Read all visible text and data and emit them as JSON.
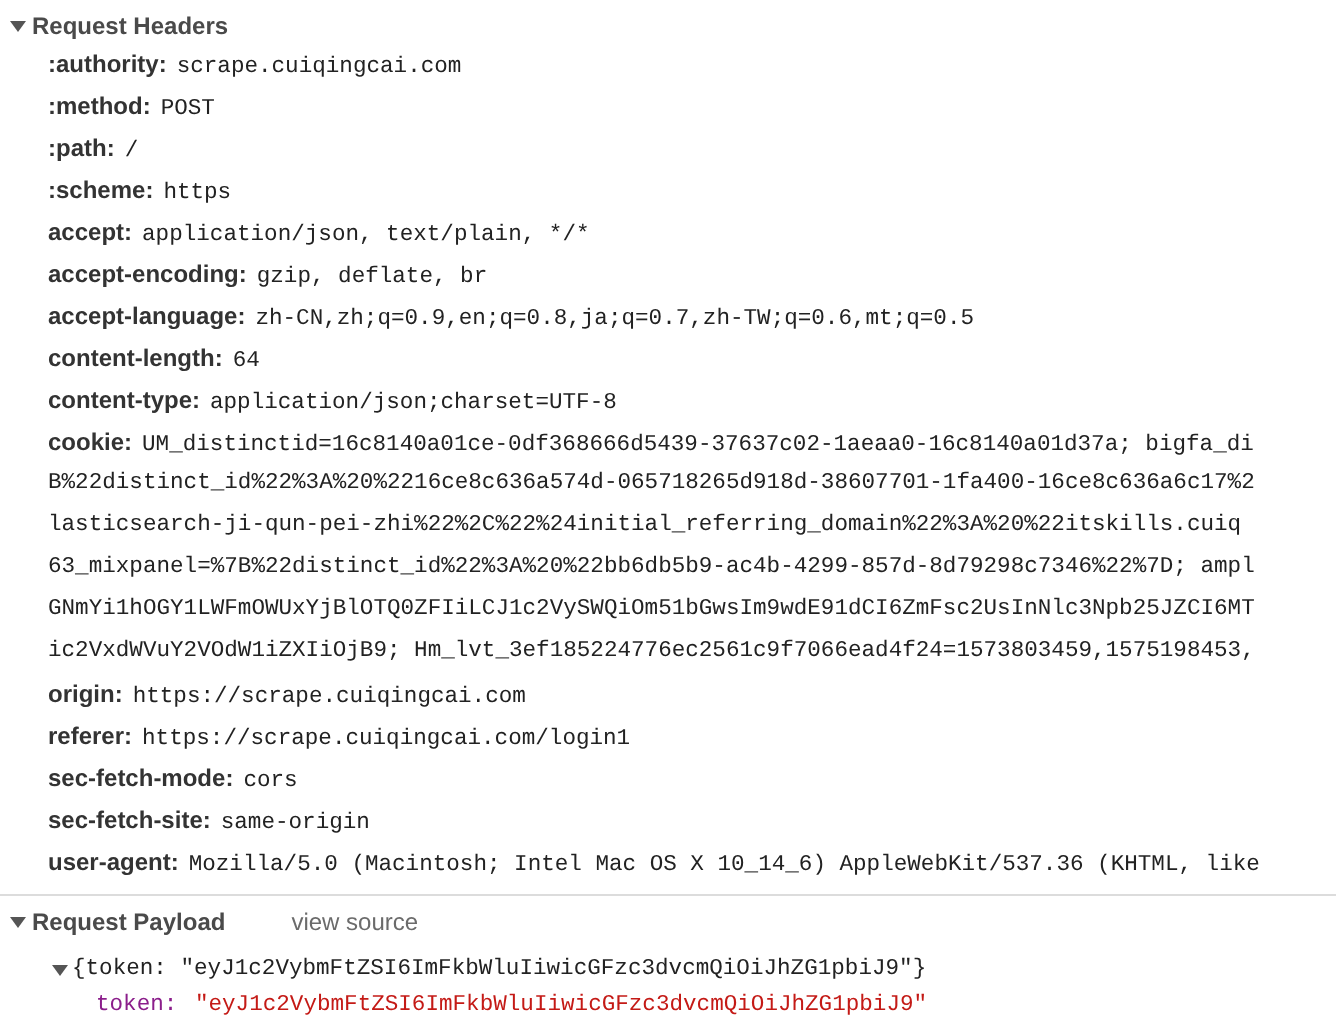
{
  "request_headers": {
    "title": "Request Headers",
    "expanded": true,
    "items": [
      {
        "name": ":authority:",
        "value": "scrape.cuiqingcai.com"
      },
      {
        "name": ":method:",
        "value": "POST"
      },
      {
        "name": ":path:",
        "value": "/"
      },
      {
        "name": ":scheme:",
        "value": "https"
      },
      {
        "name": "accept:",
        "value": "application/json, text/plain, */*"
      },
      {
        "name": "accept-encoding:",
        "value": "gzip, deflate, br"
      },
      {
        "name": "accept-language:",
        "value": "zh-CN,zh;q=0.9,en;q=0.8,ja;q=0.7,zh-TW;q=0.6,mt;q=0.5"
      },
      {
        "name": "content-length:",
        "value": "64"
      },
      {
        "name": "content-type:",
        "value": "application/json;charset=UTF-8"
      },
      {
        "name": "cookie:",
        "value": "UM_distinctid=16c8140a01ce-0df368666d5439-37637c02-1aeaa0-16c8140a01d37a; bigfa_di",
        "continuation": [
          "B%22distinct_id%22%3A%20%2216ce8c636a574d-065718265d918d-38607701-1fa400-16ce8c636a6c17%2",
          "lasticsearch-ji-qun-pei-zhi%22%2C%22%24initial_referring_domain%22%3A%20%22itskills.cuiq",
          "63_mixpanel=%7B%22distinct_id%22%3A%20%22bb6db5b9-ac4b-4299-857d-8d79298c7346%22%7D; ampl",
          "GNmYi1hOGY1LWFmOWUxYjBlOTQ0ZFIiLCJ1c2VySWQiOm51bGwsIm9wdE91dCI6ZmFsc2UsInNlc3Npb25JZCI6MT",
          "ic2VxdWVuY2VOdW1iZXIiOjB9; Hm_lvt_3ef185224776ec2561c9f7066ead4f24=1573803459,1575198453,"
        ]
      },
      {
        "name": "origin:",
        "value": "https://scrape.cuiqingcai.com"
      },
      {
        "name": "referer:",
        "value": "https://scrape.cuiqingcai.com/login1"
      },
      {
        "name": "sec-fetch-mode:",
        "value": "cors"
      },
      {
        "name": "sec-fetch-site:",
        "value": "same-origin"
      },
      {
        "name": "user-agent:",
        "value": "Mozilla/5.0 (Macintosh; Intel Mac OS X 10_14_6) AppleWebKit/537.36 (KHTML, like"
      }
    ]
  },
  "request_payload": {
    "title": "Request Payload",
    "expanded": true,
    "action": "view source",
    "object": {
      "summary": "{token: \"eyJ1c2VybmFtZSI6ImFkbWluIiwicGFzc3dvcmQiOiJhZG1pbiJ9\"}",
      "expanded": true,
      "properties": [
        {
          "key": "token:",
          "value": "\"eyJ1c2VybmFtZSI6ImFkbWluIiwicGFzc3dvcmQiOiJhZG1pbiJ9\""
        }
      ]
    }
  }
}
